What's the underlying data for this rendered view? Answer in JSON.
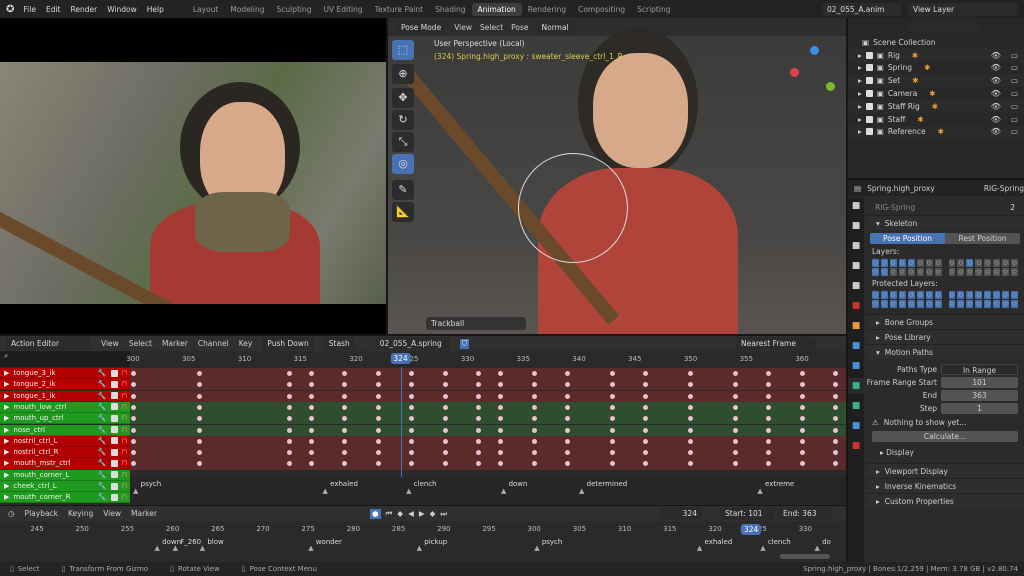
{
  "topbar": {
    "menus": [
      "File",
      "Edit",
      "Render",
      "Window",
      "Help"
    ],
    "workspaces": [
      "Layout",
      "Modeling",
      "Sculpting",
      "UV Editing",
      "Texture Paint",
      "Shading",
      "Animation",
      "Rendering",
      "Compositing",
      "Scripting"
    ],
    "active_workspace": "Animation",
    "scene": "02_055_A.anim",
    "view_layer": "View Layer"
  },
  "viewport": {
    "mode": "Pose Mode",
    "menus": [
      "View",
      "Select",
      "Pose"
    ],
    "orientation": "Normal",
    "title": "User Perspective (Local)",
    "subtitle": "(324) Spring.high_proxy : sweater_sleeve_ctrl_1_R",
    "last_op": "Trackball"
  },
  "outliner": {
    "root": "Scene Collection",
    "items": [
      "Rig",
      "Spring",
      "Set",
      "Camera",
      "Staff Rig",
      "Staff",
      "Reference"
    ]
  },
  "properties": {
    "object": "Spring.high_proxy",
    "armature": "RIG-Spring",
    "data_name": "RIG-Spring",
    "users": "2",
    "skeleton": "Skeleton",
    "pose_position": "Pose Position",
    "rest_position": "Rest Position",
    "layers": "Layers:",
    "protected_layers": "Protected Layers:",
    "bone_groups": "Bone Groups",
    "pose_library": "Pose Library",
    "motion_paths": "Motion Paths",
    "paths_type_label": "Paths Type",
    "paths_type": "In Range",
    "frame_start_label": "Frame Range Start",
    "frame_start": "101",
    "end_label": "End",
    "end": "363",
    "step_label": "Step",
    "step": "1",
    "warning": "Nothing to show yet...",
    "calculate": "Calculate...",
    "display": "Display",
    "viewport_display": "Viewport Display",
    "inverse_kinematics": "Inverse Kinematics",
    "custom_properties": "Custom Properties"
  },
  "action_editor": {
    "mode": "Action Editor",
    "menus": [
      "View",
      "Select",
      "Marker",
      "Channel",
      "Key"
    ],
    "push_down": "Push Down",
    "stash": "Stash",
    "action": "02_055_A.spring",
    "snap": "Nearest Frame",
    "current_frame": "324",
    "ticks": [
      "300",
      "305",
      "310",
      "315",
      "320",
      "325",
      "330",
      "335",
      "340",
      "345",
      "350",
      "355",
      "360"
    ],
    "channels": [
      {
        "name": "tongue_3_ik",
        "color": "red"
      },
      {
        "name": "tongue_2_ik",
        "color": "red"
      },
      {
        "name": "tongue_1_ik",
        "color": "red"
      },
      {
        "name": "mouth_low_ctrl",
        "color": "green"
      },
      {
        "name": "mouth_up_ctrl",
        "color": "green"
      },
      {
        "name": "nose_ctrl",
        "color": "green"
      },
      {
        "name": "nostril_ctrl_L",
        "color": "red"
      },
      {
        "name": "nostril_ctrl_R",
        "color": "red"
      },
      {
        "name": "mouth_mstr_ctrl",
        "color": "red"
      },
      {
        "name": "mouth_corner_L",
        "color": "green"
      },
      {
        "name": "cheek_ctrl_L",
        "color": "green"
      },
      {
        "name": "mouth_corner_R",
        "color": "green"
      }
    ],
    "keyframe_frames": [
      300,
      306,
      314,
      316,
      319,
      322,
      325,
      328,
      331,
      333,
      336,
      339,
      343,
      346,
      350,
      354,
      357,
      360,
      363
    ],
    "markers": [
      {
        "name": "psych",
        "frame": 300
      },
      {
        "name": "exhaled",
        "frame": 317
      },
      {
        "name": "clench",
        "frame": 324.5
      },
      {
        "name": "down",
        "frame": 333
      },
      {
        "name": "determined",
        "frame": 340
      },
      {
        "name": "extreme",
        "frame": 356
      }
    ]
  },
  "timeline": {
    "menus": [
      "Playback",
      "Keying",
      "View",
      "Marker"
    ],
    "current_frame": "324",
    "start_label": "Start:",
    "start": "101",
    "end_label": "End:",
    "end": "363",
    "ticks": [
      "245",
      "250",
      "255",
      "260",
      "265",
      "270",
      "275",
      "280",
      "285",
      "290",
      "295",
      "300",
      "305",
      "310",
      "315",
      "320",
      "325",
      "330"
    ],
    "markers": [
      {
        "name": "down",
        "frame": 258
      },
      {
        "name": "F_260",
        "frame": 260
      },
      {
        "name": "blow",
        "frame": 263
      },
      {
        "name": "wonder",
        "frame": 275
      },
      {
        "name": "pickup",
        "frame": 287
      },
      {
        "name": "psych",
        "frame": 300
      },
      {
        "name": "exhaled",
        "frame": 318
      },
      {
        "name": "clench",
        "frame": 325
      },
      {
        "name": "do",
        "frame": 331
      }
    ]
  },
  "status": {
    "items": [
      "Select",
      "Transform From Gizmo",
      "Rotate View",
      "Pose Context Menu"
    ],
    "info": "Spring.high_proxy | Bones:1/2,259 | Mem: 3.78 GB | v2.80.74"
  },
  "colors": {
    "accent": "#4772b3",
    "red_channel": "#b40000",
    "green_channel": "#1f9a1f",
    "keyframe": "#e8c0d0"
  }
}
